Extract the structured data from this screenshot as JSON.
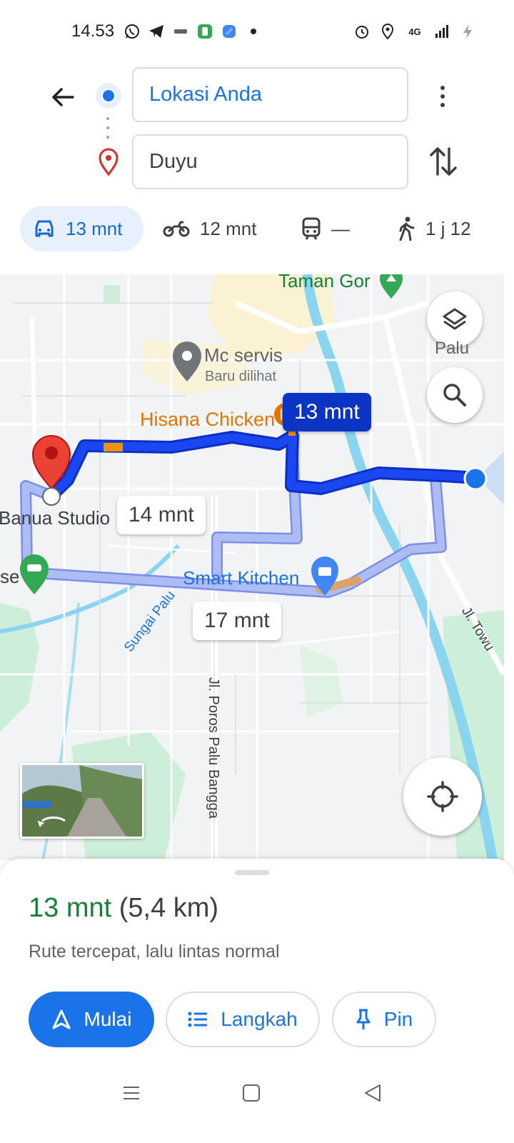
{
  "status_bar": {
    "time": "14.53",
    "left_icons": [
      "whatsapp-icon",
      "telegram-icon",
      "app-icon",
      "app-green-icon",
      "app-blue-icon",
      "dot-icon"
    ],
    "right_icons": [
      "alarm-icon",
      "location-icon",
      "network-4g-icon",
      "signal-icon",
      "battery-charging-icon"
    ],
    "network_label": "4G"
  },
  "directions": {
    "origin": "Lokasi Anda",
    "destination": "Duyu"
  },
  "modes": [
    {
      "name": "car",
      "label": "13 mnt",
      "active": true
    },
    {
      "name": "motorcycle",
      "label": "12 mnt",
      "active": false
    },
    {
      "name": "transit",
      "label": "—",
      "active": false
    },
    {
      "name": "walk",
      "label": "1 j 12",
      "active": false
    }
  ],
  "map": {
    "labels": {
      "park": "Taman Gor",
      "layers_label": "Palu",
      "poi_recent": "Mc servis",
      "poi_recent_sub": "Baru dilihat",
      "restaurant": "Hisana Chicken",
      "studio": "Banua Studio",
      "left_edge": "se",
      "shop": "Smart Kitchen",
      "river": "Sungai Palu",
      "road_poros": "Jl. Poros Palu Bangga",
      "road_towua": "Jl. Towu"
    },
    "route_times": {
      "selected": "13 mnt",
      "alt_1": "14 mnt",
      "alt_2": "17 mnt"
    }
  },
  "sheet": {
    "duration": "13 mnt",
    "distance": "(5,4 km)",
    "description": "Rute tercepat, lalu lintas normal",
    "start_label": "Mulai",
    "steps_label": "Langkah",
    "pin_label": "Pin"
  },
  "colors": {
    "primary_blue": "#1a73e8",
    "route_blue": "#1b47f0",
    "alt_route": "#a8b8f0",
    "green": "#188038",
    "orange": "#e37400"
  }
}
